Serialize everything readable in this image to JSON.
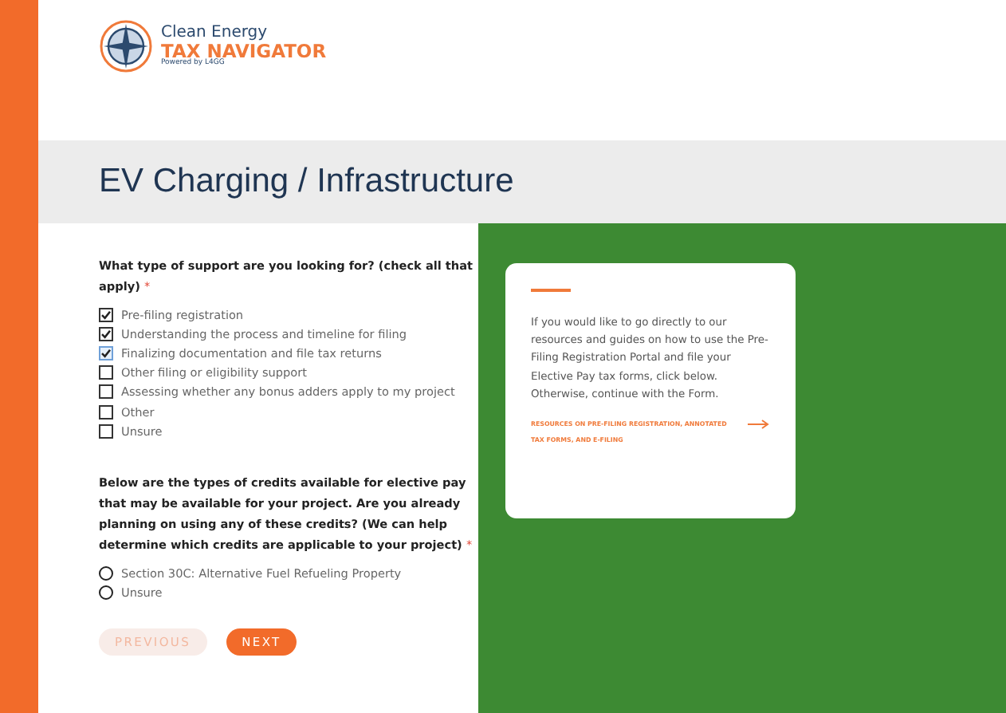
{
  "logo": {
    "line1": "Clean Energy",
    "line2": "TAX NAVIGATOR",
    "line3": "Powered by L4GG"
  },
  "title": "EV Charging / Infrastructure",
  "questions": [
    {
      "kind": "checkbox",
      "text": "What type of support are you looking for? (check all that apply)",
      "required_mark": "*",
      "options": [
        {
          "label": "Pre-filing registration",
          "checked": true,
          "focused": false
        },
        {
          "label": "Understanding the process and timeline for filing",
          "checked": true,
          "focused": false
        },
        {
          "label": "Finalizing documentation and file tax returns",
          "checked": true,
          "focused": true
        },
        {
          "label": "Other filing or eligibility support",
          "checked": false,
          "focused": false
        },
        {
          "label": "Assessing whether any bonus adders apply to my project",
          "checked": false,
          "focused": false
        },
        {
          "label": "Other",
          "checked": false,
          "focused": false
        },
        {
          "label": "Unsure",
          "checked": false,
          "focused": false
        }
      ]
    },
    {
      "kind": "radio",
      "text": "Below are the types of credits available for elective pay that may be available for your project. Are you already planning on using any of these credits? (We can help determine which credits are applicable to your project)",
      "required_mark": "*",
      "options": [
        {
          "label": "Section 30C: Alternative Fuel Refueling Property",
          "selected": false
        },
        {
          "label": "Unsure",
          "selected": false
        }
      ]
    }
  ],
  "buttons": [
    {
      "label": "PREVIOUS",
      "disabled": true
    },
    {
      "label": "NEXT",
      "disabled": false
    }
  ],
  "card": {
    "text": "If you would like to go directly to our resources and guides on how to use the Pre-Filing Registration Portal and file your Elective Pay tax forms, click below. Otherwise, continue with the Form.",
    "link": "RESOURCES ON PRE-FILING REGISTRATION, ANNOTATED TAX FORMS, AND E-FILING"
  }
}
